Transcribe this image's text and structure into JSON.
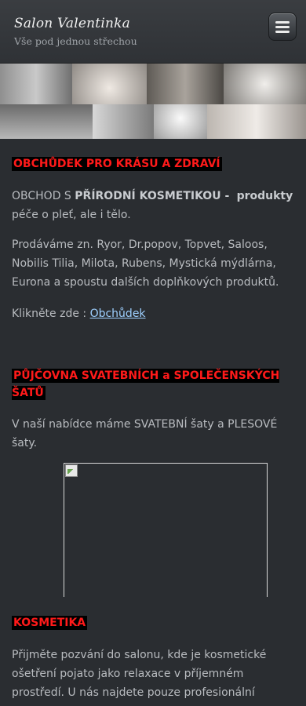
{
  "header": {
    "title": "Salon Valentinka",
    "subtitle": "Vše pod jednou střechou"
  },
  "sections": [
    {
      "heading": "OBCHŮDEK PRO KRÁSU A ZDRAVÍ",
      "line1_prefix": "OBCHOD S ",
      "line1_bold": "PŘÍRODNÍ KOSMETIKOU - ",
      "line1_bold2": "produkty",
      "line1_rest": "péče o pleť, ale i  tělo.",
      "paragraph2": "Prodáváme zn. Ryor, Dr.popov, Topvet, Saloos, Nobilis Tilia, Milota, Rubens, Mystická mýdlárna, Eurona a spoustu dalších  doplňkových produktů.",
      "link_prefix": "Klikněte zde : ",
      "link_label": "Obchůdek"
    },
    {
      "heading": "PŮJČOVNA SVATEBNÍCH a SPOLEČENSKÝCH ŠATŮ",
      "paragraph": "V naší nabídce máme  SVATEBNÍ  šaty  a  PLESOVÉ šaty."
    },
    {
      "heading": "KOSMETIKA",
      "paragraph": "Přijměte pozvání do salonu, kde je kosmetické ošetření pojato jako relaxace v příjemném prostředí. U nás najdete pouze profesionální"
    }
  ],
  "colors": {
    "heading_text": "#ff1a1a",
    "heading_bg": "#000000",
    "link": "#9ed0ff",
    "background": "#2a2d31"
  },
  "icons": {
    "menu": "hamburger-menu-icon",
    "broken_image": "broken-image-icon"
  }
}
